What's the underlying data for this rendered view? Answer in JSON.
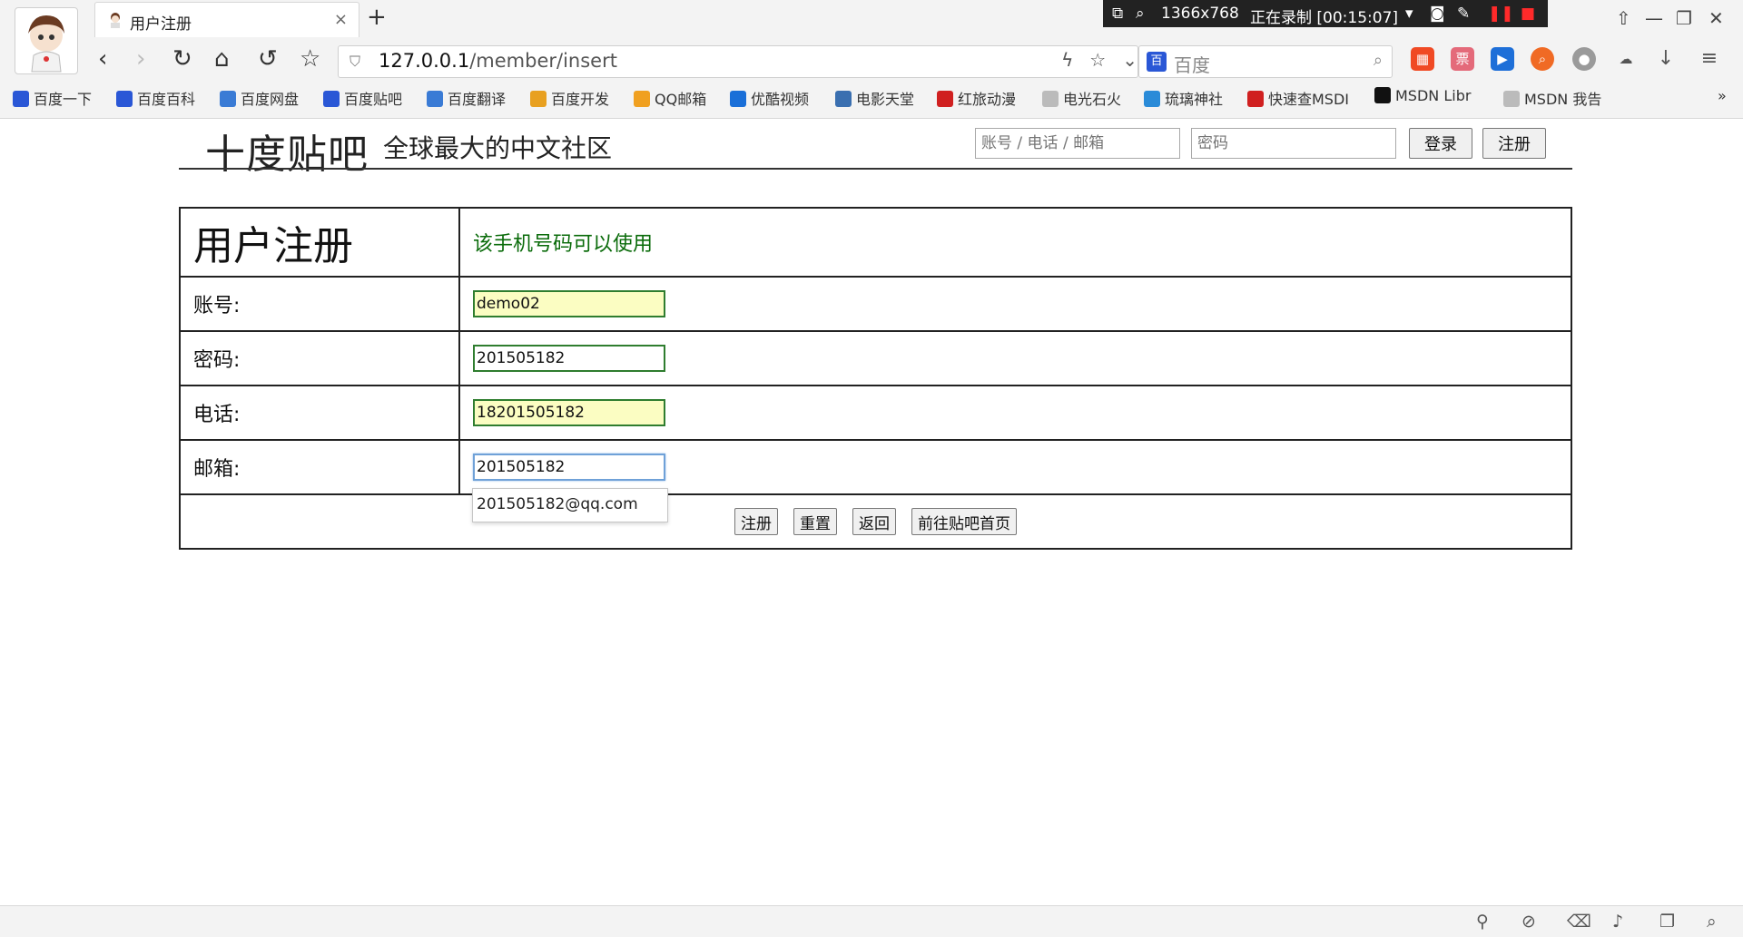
{
  "browser": {
    "tab_title": "用户注册",
    "new_tab": "+",
    "tab_close": "×",
    "url_host": "127.0.0.1",
    "url_path": "/member/insert",
    "search_placeholder": "百度",
    "search_engine_icon": "百",
    "recording": {
      "resolution": "1366x768",
      "status": "正在录制 [00:15:07]"
    },
    "nav_icons": [
      "back-icon",
      "forward-icon",
      "reload-icon",
      "home-icon",
      "undo-icon",
      "star-icon"
    ],
    "bookmarks": [
      {
        "label": "百度一下",
        "color": "#2a57d6"
      },
      {
        "label": "百度百科",
        "color": "#2a57d6"
      },
      {
        "label": "百度网盘",
        "color": "#3a7bd5"
      },
      {
        "label": "百度贴吧",
        "color": "#2a57d6"
      },
      {
        "label": "百度翻译",
        "color": "#3a7bd5"
      },
      {
        "label": "百度开发",
        "color": "#e8a020"
      },
      {
        "label": "QQ邮箱",
        "color": "#f0a020"
      },
      {
        "label": "优酷视频",
        "color": "#1a6fd8"
      },
      {
        "label": "电影天堂",
        "color": "#3a6fb0"
      },
      {
        "label": "红旅动漫",
        "color": "#d02020"
      },
      {
        "label": "电光石火",
        "color": "#bbbbbb"
      },
      {
        "label": "琉璃神社",
        "color": "#2a8bd8"
      },
      {
        "label": "快速查MSDI",
        "color": "#d02020"
      },
      {
        "label": "MSDN Libr",
        "color": "#111111"
      },
      {
        "label": "MSDN 我告",
        "color": "#bbbbbb"
      }
    ],
    "bookmarks_more": "»"
  },
  "header": {
    "logo": "十度贴吧",
    "slogan": "全球最大的中文社区",
    "account_placeholder": "账号 / 电话 / 邮箱",
    "password_placeholder": "密码",
    "login_label": "登录",
    "register_label": "注册"
  },
  "form": {
    "title": "用户注册",
    "message": "该手机号码可以使用",
    "account_label": "账号:",
    "account_value": "demo02",
    "password_label": "密码:",
    "password_value": "201505182",
    "phone_label": "电话:",
    "phone_value": "18201505182",
    "email_label": "邮箱:",
    "email_value": "201505182",
    "email_suggestion": "201505182@qq.com",
    "buttons": {
      "register": "注册",
      "reset": "重置",
      "back": "返回",
      "goto_home": "前往贴吧首页"
    }
  },
  "colors": {
    "success_text": "#0a6b0a",
    "autofill_bg": "#fbfdc2",
    "valid_border": "#2f7d2f",
    "focus_border": "#6fa1d8"
  }
}
